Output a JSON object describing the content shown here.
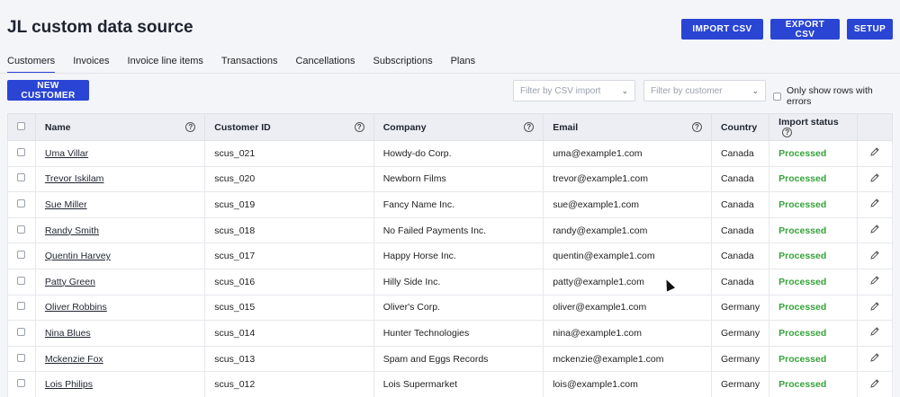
{
  "page": {
    "title": "JL custom data source"
  },
  "toolbar": {
    "import_label": "IMPORT CSV",
    "export_label": "EXPORT CSV",
    "setup_label": "SETUP"
  },
  "tabs": [
    {
      "label": "Customers"
    },
    {
      "label": "Invoices"
    },
    {
      "label": "Invoice line items"
    },
    {
      "label": "Transactions"
    },
    {
      "label": "Cancellations"
    },
    {
      "label": "Subscriptions"
    },
    {
      "label": "Plans"
    }
  ],
  "actions": {
    "new_customer_label": "NEW CUSTOMER"
  },
  "filters": {
    "csv_import_placeholder": "Filter by CSV import",
    "customer_placeholder": "Filter by customer",
    "errors_only_label": "Only show rows with errors"
  },
  "table": {
    "headers": {
      "name": "Name",
      "customer_id": "Customer ID",
      "company": "Company",
      "email": "Email",
      "country": "Country",
      "import_status": "Import status"
    },
    "rows": [
      {
        "name": "Uma Villar",
        "id": "scus_021",
        "company": "Howdy-do Corp.",
        "email": "uma@example1.com",
        "country": "Canada",
        "status": "Processed"
      },
      {
        "name": "Trevor Iskilam",
        "id": "scus_020",
        "company": "Newborn Films",
        "email": "trevor@example1.com",
        "country": "Canada",
        "status": "Processed"
      },
      {
        "name": "Sue Miller",
        "id": "scus_019",
        "company": "Fancy Name Inc.",
        "email": "sue@example1.com",
        "country": "Canada",
        "status": "Processed"
      },
      {
        "name": "Randy Smith",
        "id": "scus_018",
        "company": "No Failed Payments Inc.",
        "email": "randy@example1.com",
        "country": "Canada",
        "status": "Processed"
      },
      {
        "name": "Quentin Harvey",
        "id": "scus_017",
        "company": "Happy Horse Inc.",
        "email": "quentin@example1.com",
        "country": "Canada",
        "status": "Processed"
      },
      {
        "name": "Patty Green",
        "id": "scus_016",
        "company": "Hilly Side Inc.",
        "email": "patty@example1.com",
        "country": "Canada",
        "status": "Processed"
      },
      {
        "name": "Oliver Robbins",
        "id": "scus_015",
        "company": "Oliver's Corp.",
        "email": "oliver@example1.com",
        "country": "Germany",
        "status": "Processed"
      },
      {
        "name": "Nina Blues",
        "id": "scus_014",
        "company": "Hunter Technologies",
        "email": "nina@example1.com",
        "country": "Germany",
        "status": "Processed"
      },
      {
        "name": "Mckenzie Fox",
        "id": "scus_013",
        "company": "Spam and Eggs Records",
        "email": "mckenzie@example1.com",
        "country": "Germany",
        "status": "Processed"
      },
      {
        "name": "Lois Philips",
        "id": "scus_012",
        "company": "Lois Supermarket",
        "email": "lois@example1.com",
        "country": "Germany",
        "status": "Processed"
      }
    ]
  },
  "colors": {
    "accent": "#2a45d4",
    "success": "#36a33b"
  },
  "icons": {
    "help": "question-circle-icon",
    "edit": "pencil-icon",
    "dropdown": "chevron-down-icon"
  }
}
